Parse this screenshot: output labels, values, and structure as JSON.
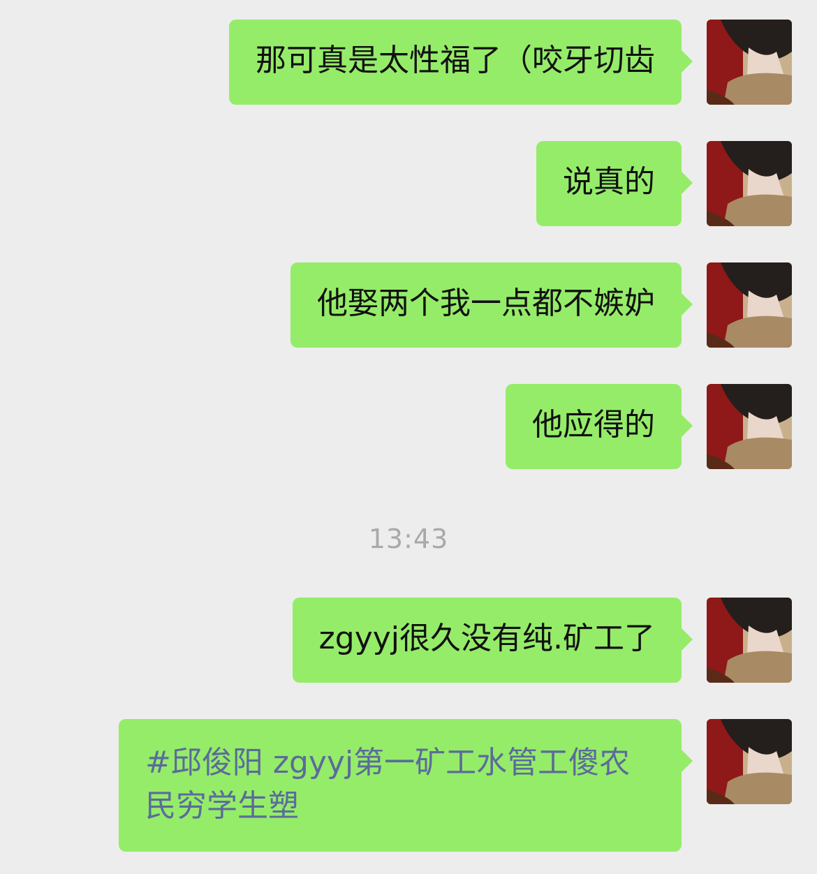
{
  "messages": [
    {
      "text": "那可真是太性福了（咬牙切齿"
    },
    {
      "text": "说真的"
    },
    {
      "text": "他娶两个我一点都不嫉妒"
    },
    {
      "text": "他应得的"
    },
    {
      "text": "zgyyj很久没有纯.矿工了"
    },
    {
      "text": "#邱俊阳 zgyyj第一矿工水管工傻农民穷学生塑"
    }
  ],
  "timestamp": "13:43",
  "colors": {
    "background": "#ededed",
    "bubble": "#95ec69",
    "hashtag_text": "#5b6b9a",
    "timestamp_text": "#a9a9a9"
  },
  "icons": {
    "avatar": "user-avatar-photo"
  }
}
